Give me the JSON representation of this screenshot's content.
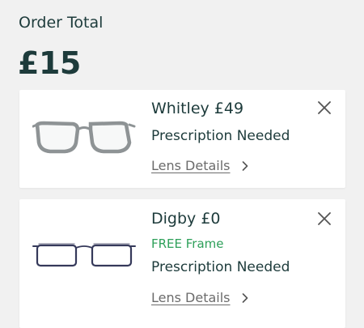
{
  "order": {
    "total_label": "Order Total",
    "total_amount": "£15"
  },
  "items": [
    {
      "name": "Whitley",
      "price": "£49",
      "prescription_status": "Prescription Needed",
      "lens_link": "Lens Details",
      "frame_color": "#8e9395"
    },
    {
      "name": "Digby",
      "price": "£0",
      "promo": "FREE Frame",
      "prescription_status": "Prescription Needed",
      "lens_link": "Lens Details",
      "frame_color": "#35395a"
    }
  ],
  "icons": {
    "remove": "close-icon",
    "lens_arrow": "chevron-right-icon"
  },
  "colors": {
    "primary_text": "#1d3b3b",
    "promo_green": "#2ea05a",
    "link_grey": "#6b6b6b",
    "background": "#f1f1f1",
    "card": "#ffffff"
  }
}
